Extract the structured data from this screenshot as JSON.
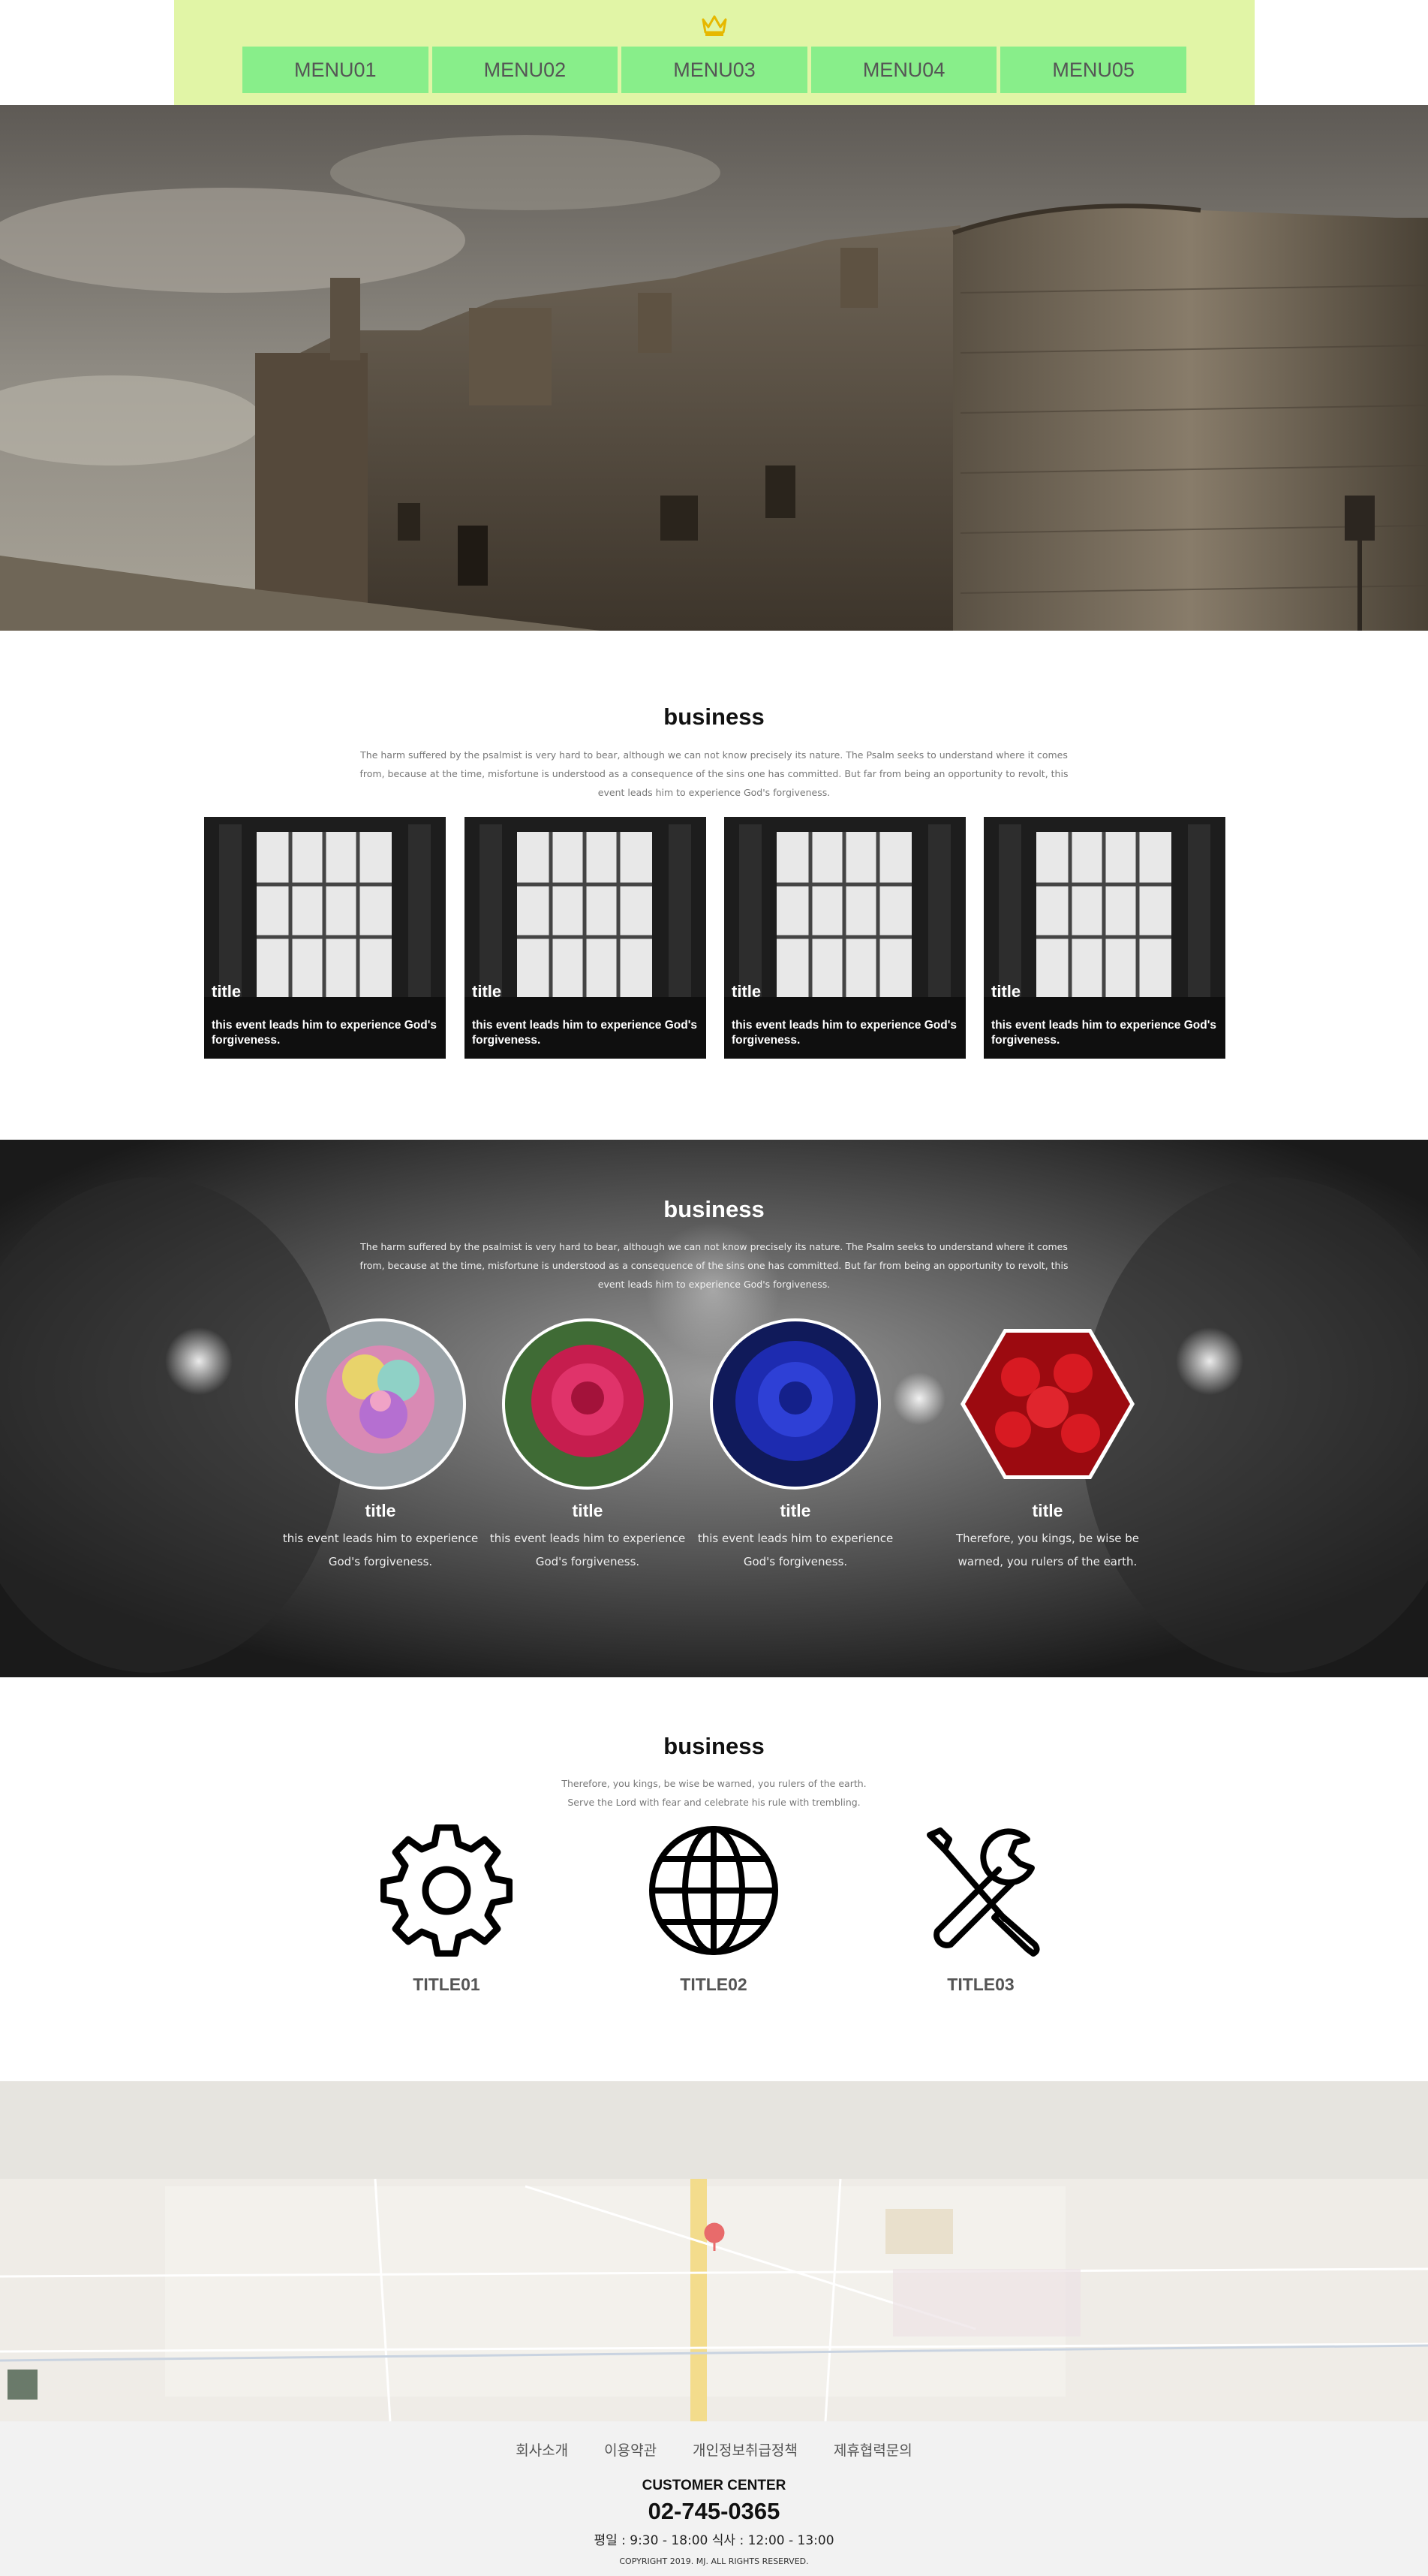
{
  "colors": {
    "header_bg": "#e1f5a6",
    "menu_bg": "#88ee8a",
    "footer_bg": "#f2f2f2",
    "map_pin": "#e86b6b"
  },
  "header": {
    "logo_icon": "crown-icon",
    "menu": [
      {
        "label": "MENU01"
      },
      {
        "label": "MENU02"
      },
      {
        "label": "MENU03"
      },
      {
        "label": "MENU04"
      },
      {
        "label": "MENU05"
      }
    ]
  },
  "hero": {
    "image": "castle-photo"
  },
  "section1": {
    "title": "business",
    "description": "The harm suffered by the psalmist is very hard to bear, although we can not know precisely its nature. The Psalm seeks to understand where it comes from, because at the time, misfortune is understood as a consequence of the sins one has committed. But far from being an opportunity to revolt, this event leads him to experience God's forgiveness.",
    "cards": [
      {
        "title": "title",
        "text": "this event leads him to experience God's forgiveness."
      },
      {
        "title": "title",
        "text": "this event leads him to experience God's forgiveness."
      },
      {
        "title": "title",
        "text": "this event leads him to experience God's forgiveness."
      },
      {
        "title": "title",
        "text": "this event leads him to experience God's forgiveness."
      }
    ]
  },
  "section2": {
    "title": "business",
    "description": "The harm suffered by the psalmist is very hard to bear, although we can not know precisely its nature. The Psalm seeks to understand where it comes from, because at the time, misfortune is understood as a consequence of the sins one has committed. But far from being an opportunity to revolt, this event leads him to experience God's forgiveness.",
    "items": [
      {
        "title": "title",
        "text": "this event leads him to experience God's forgiveness."
      },
      {
        "title": "title",
        "text": "this event leads him to experience God's forgiveness."
      },
      {
        "title": "title",
        "text": "this event leads him to experience God's forgiveness."
      },
      {
        "title": "title",
        "text": "Therefore, you kings, be wise be warned, you rulers of the earth."
      }
    ]
  },
  "section3": {
    "title": "business",
    "description_line1": "Therefore, you kings, be wise be warned, you rulers of the earth.",
    "description_line2": "Serve the Lord with fear and celebrate his rule with trembling.",
    "services": [
      {
        "icon": "gear-icon",
        "title": "TITLE01"
      },
      {
        "icon": "globe-icon",
        "title": "TITLE02"
      },
      {
        "icon": "tools-icon",
        "title": "TITLE03"
      }
    ]
  },
  "map": {
    "image": "street-map"
  },
  "footer": {
    "links": [
      "회사소개",
      "이용약관",
      "개인정보취급정책",
      "제휴협력문의"
    ],
    "customer_center": "CUSTOMER CENTER",
    "phone": "02-745-0365",
    "hours": "평일 : 9:30 - 18:00 식사 : 12:00 - 13:00",
    "copyright": "COPYRIGHT 2019. MJ. ALL RIGHTS RESERVED."
  }
}
